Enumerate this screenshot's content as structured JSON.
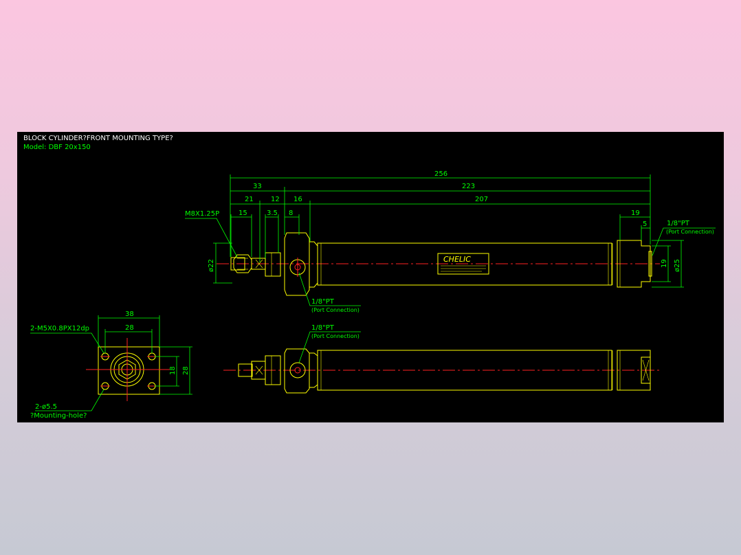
{
  "title": "BLOCK CYLINDER?FRONT MOUNTING TYPE?",
  "model": "Model: DBF 20x150",
  "colors": {
    "background": "#000000",
    "object_lines": "#ffff00",
    "dimension_lines": "#00ff00",
    "center_lines": "#ff2222",
    "title_text": "#ffffff"
  },
  "side_view": {
    "dims": {
      "overall": "256",
      "stroke_plus_body": "223",
      "front_block": "33",
      "body": "207",
      "rod_length": "21",
      "block_width": "12",
      "thread_length": "15",
      "flats": "3.5",
      "collar": "8",
      "front_collar": "16",
      "end_cap": "19",
      "end_step": "5",
      "end_height": "19",
      "body_dia": "ø25",
      "rod_end_dia": "ø22"
    },
    "thread_label": "M8X1.25P",
    "port_rear": "1/8\"PT",
    "port_rear_sub": "(Port Connection)",
    "port_front": "1/8\"PT",
    "port_front_sub": "(Port Connection)",
    "brand": "CHELIC"
  },
  "front_view": {
    "width_outer": "38",
    "width_inner": "28",
    "height_outer": "28",
    "height_inner": "18",
    "tapped_holes": "2-M5X0.8PX12dp",
    "mount_holes": "2-ø5.5",
    "mount_note": "?Mounting-hole?"
  },
  "bottom_view": {
    "port": "1/8\"PT",
    "port_sub": "(Port Connection)"
  }
}
